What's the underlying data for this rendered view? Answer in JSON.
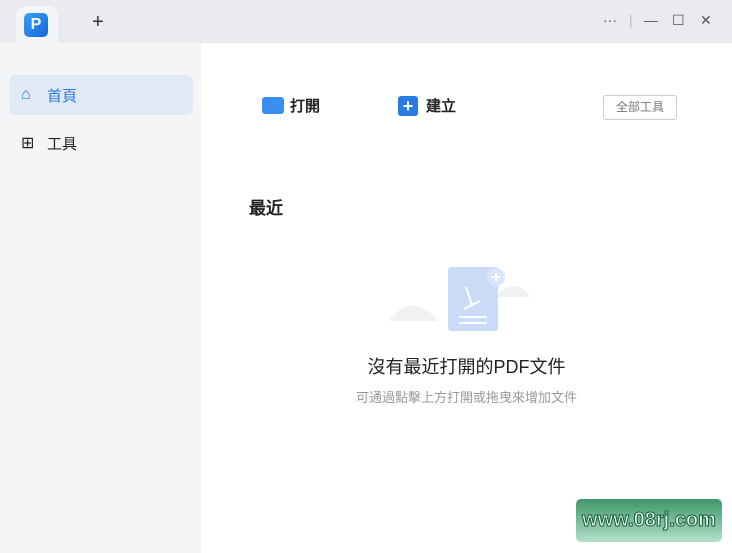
{
  "titlebar": {
    "new_tab": "+",
    "more": "···",
    "minimize": "—",
    "maximize": "☐",
    "close": "✕"
  },
  "sidebar": {
    "items": [
      {
        "label": "首頁",
        "icon": "home-icon"
      },
      {
        "label": "工具",
        "icon": "grid-icon"
      }
    ]
  },
  "main": {
    "open_label": "打開",
    "create_label": "建立",
    "all_tools_label": "全部工具",
    "recent_heading": "最近",
    "empty_title": "沒有最近打開的PDF文件",
    "empty_hint": "可通過點擊上方打開或拖曳來增加文件"
  },
  "watermark": "www.08rj.com"
}
